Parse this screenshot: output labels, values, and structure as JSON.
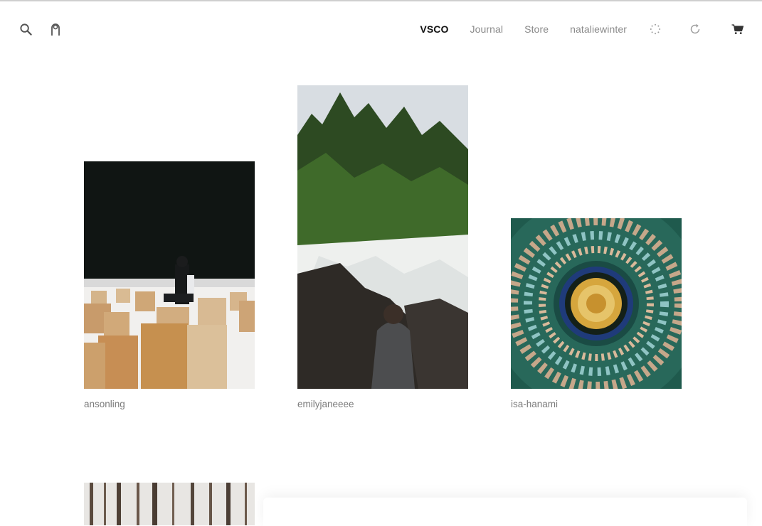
{
  "nav": {
    "brand": "VSCO",
    "links": [
      "Journal",
      "Store",
      "nataliewinter"
    ]
  },
  "icons": {
    "left": [
      "search-icon",
      "user-icon"
    ],
    "right": [
      "loading-icon",
      "refresh-icon",
      "cart-icon"
    ]
  },
  "colors": {
    "active_nav": "#111111",
    "inactive_nav": "#8a8a8a",
    "caption": "#7b7b7b"
  },
  "grid": {
    "items": [
      {
        "username": "ansonling"
      },
      {
        "username": "emilyjaneeee"
      },
      {
        "username": "isa-hanami"
      },
      {
        "username": ""
      }
    ]
  }
}
